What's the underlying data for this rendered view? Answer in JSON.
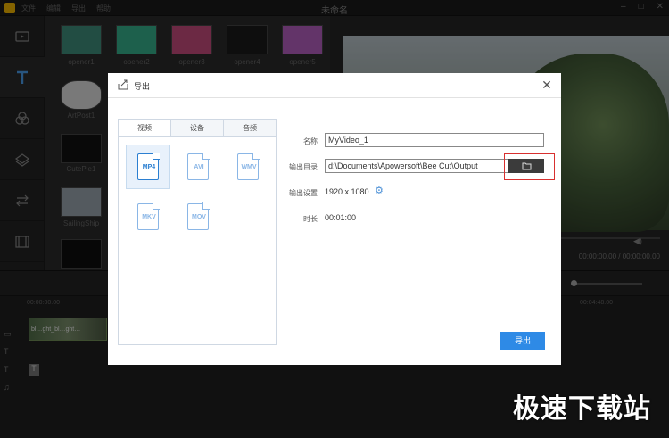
{
  "app": {
    "window_title": "未命名",
    "menu": [
      "文件",
      "编辑",
      "导出",
      "帮助"
    ]
  },
  "library": {
    "items": [
      {
        "label": "opener1",
        "color": "#3f8c7a"
      },
      {
        "label": "opener2",
        "color": "#36b08a"
      },
      {
        "label": "opener3",
        "color": "#c54b7d"
      },
      {
        "label": "opener4",
        "color": "#1a1a1a"
      },
      {
        "label": "opener5",
        "color": "#b55fbf"
      },
      {
        "label": "ArtPost1",
        "color": "#dcdcdc"
      },
      {
        "label": "CutePie1",
        "color": "#121212"
      },
      {
        "label": "SailingShip",
        "color": "#9aa4ad"
      },
      {
        "label": "",
        "color": "#0d0d0d"
      }
    ]
  },
  "preview": {
    "timecode": "00:00:00.00 / 00:00:00.00"
  },
  "timeline": {
    "ruler": [
      "00:00:00.00",
      "00:04:48.00"
    ],
    "clip_label": "bl…ght_bl…ght…"
  },
  "dialog": {
    "title": "导出",
    "tabs": [
      "视频",
      "设备",
      "音频"
    ],
    "formats": [
      "MP4",
      "AVI",
      "WMV",
      "MKV",
      "MOV"
    ],
    "selected_format": "MP4",
    "name_label": "名称",
    "name_value": "MyVideo_1",
    "output_dir_label": "输出目录",
    "output_dir_value": "d:\\Documents\\Apowersoft\\Bee Cut\\Output",
    "output_settings_label": "输出设置",
    "output_settings_value": "1920 x 1080",
    "duration_label": "时长",
    "duration_value": "00:01:00",
    "export_button": "导出"
  },
  "watermark": "极速下载站",
  "colors": {
    "accent": "#2e8ae6",
    "highlight": "#d8302f"
  }
}
